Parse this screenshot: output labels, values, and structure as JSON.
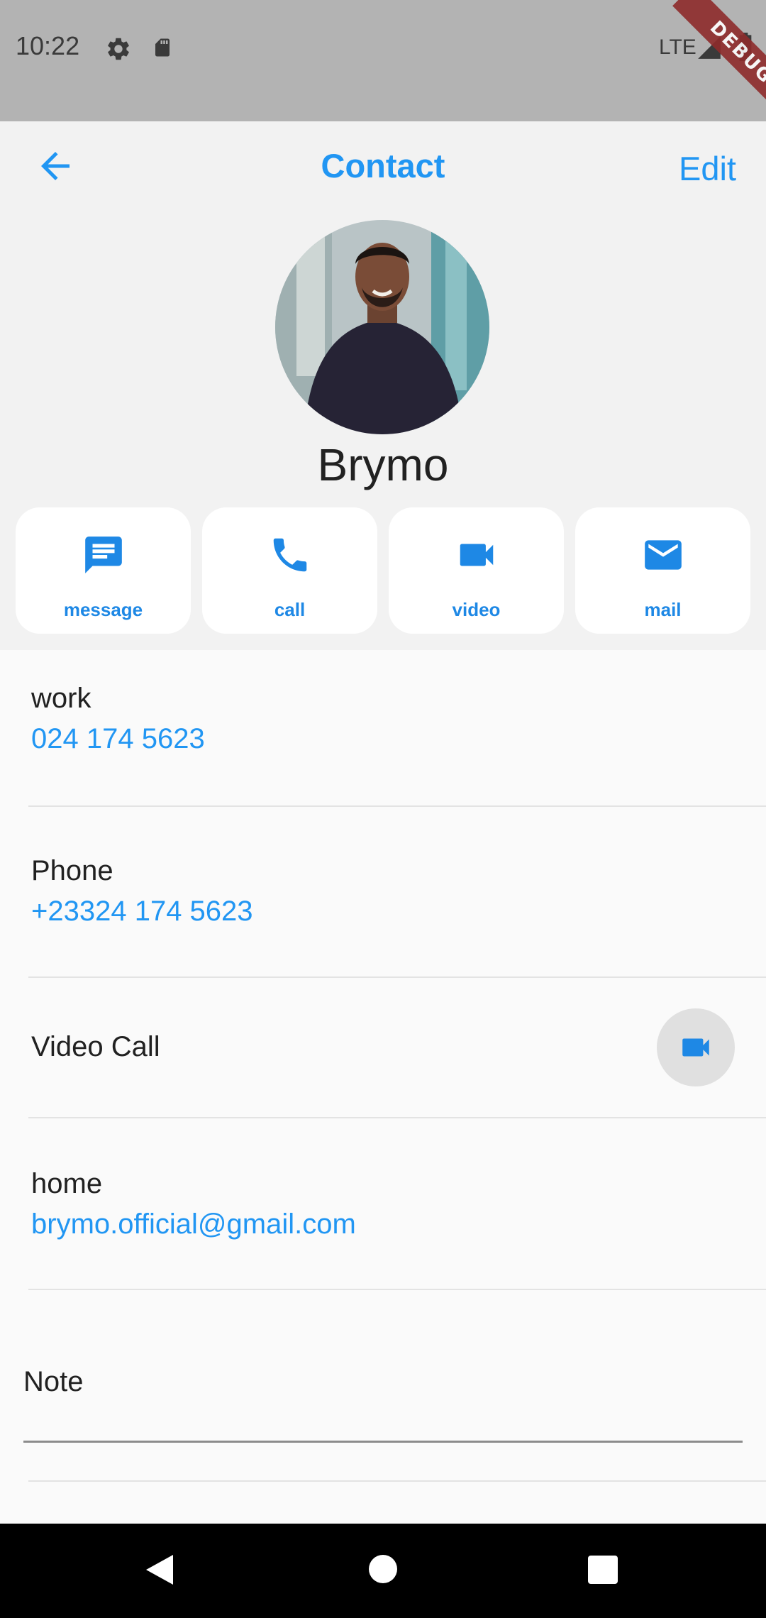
{
  "status_bar": {
    "time": "10:22",
    "network": "LTE",
    "debug_banner": "DEBUG",
    "icons": [
      "gear-icon",
      "sd-card-icon",
      "signal-icon",
      "battery-icon"
    ]
  },
  "app_bar": {
    "title": "Contact",
    "edit_label": "Edit",
    "back_icon": "arrow-back-icon"
  },
  "contact": {
    "name": "Brymo"
  },
  "actions": [
    {
      "label": "message",
      "icon": "message-icon"
    },
    {
      "label": "call",
      "icon": "phone-icon"
    },
    {
      "label": "video",
      "icon": "videocam-icon"
    },
    {
      "label": "mail",
      "icon": "mail-icon"
    }
  ],
  "details": {
    "work": {
      "label": "work",
      "value": "024 174 5623"
    },
    "phone": {
      "label": "Phone",
      "value": "+23324 174 5623"
    },
    "video_call": {
      "label": "Video Call"
    },
    "home": {
      "label": "home",
      "value": "brymo.official@gmail.com"
    },
    "note": {
      "label": "Note"
    }
  },
  "colors": {
    "accent": "#2196f3",
    "header_bg": "#f2f2f2",
    "page_bg": "#fafafa",
    "status_bar_bg": "#b3b3b3",
    "nav_bar_bg": "#000000"
  }
}
